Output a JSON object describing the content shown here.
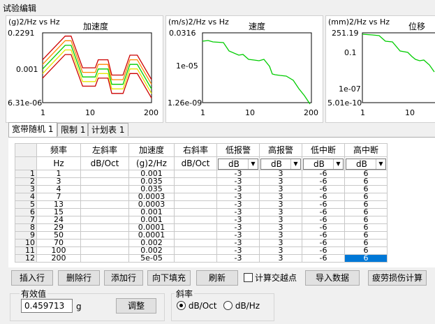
{
  "window": {
    "title": "试验编辑"
  },
  "colors": {
    "accent": "#0078d7",
    "green": "#00cc00",
    "red": "#cc0000",
    "orange": "#ff8800",
    "yellow": "#e6e600"
  },
  "charts": {
    "accel": {
      "ylabel": "(g)2/Hz vs Hz",
      "title": "加速度",
      "yticks": [
        "0.2291",
        "0.001",
        "6.31e-06"
      ],
      "xticks": [
        "1",
        "10",
        "200"
      ]
    },
    "vel": {
      "ylabel": "(m/s)2/Hz vs Hz",
      "title": "速度",
      "yticks": [
        "0.0316",
        "1e-05",
        "1.26e-09"
      ],
      "xticks": [
        "1",
        "10",
        "200"
      ]
    },
    "disp": {
      "ylabel": "(mm)2/Hz vs Hz",
      "title": "位移",
      "yticks": [
        "251.19",
        "0.1",
        "1e-07",
        "5.01e-10"
      ],
      "xticks": [
        "1",
        "10"
      ]
    }
  },
  "chart_data": [
    {
      "type": "line",
      "ylabel": "(g)2/Hz vs Hz",
      "title": "加速度",
      "xscale": "log",
      "yscale": "log",
      "xlim": [
        1,
        200
      ],
      "ylim": [
        6.31e-06,
        0.2291
      ],
      "x": [
        1,
        3,
        4,
        7,
        13,
        15,
        24,
        29,
        50,
        70,
        100,
        200
      ],
      "series": [
        {
          "values": [
            0.001,
            0.035,
            0.035,
            0.0003,
            0.0003,
            0.001,
            0.001,
            0.0001,
            0.0001,
            0.002,
            0.002,
            5e-05
          ]
        }
      ]
    },
    {
      "type": "line",
      "ylabel": "(m/s)2/Hz vs Hz",
      "title": "速度",
      "xscale": "log",
      "yscale": "log",
      "xlim": [
        1,
        200
      ],
      "ylim": [
        1.26e-09,
        0.0316
      ]
    },
    {
      "type": "line",
      "ylabel": "(mm)2/Hz vs Hz",
      "title": "位移",
      "xscale": "log",
      "yscale": "log",
      "ylim": [
        5.01e-10,
        251.19
      ]
    }
  ],
  "tabs": [
    "宽带随机 1",
    "限制 1",
    "计划表 1"
  ],
  "table": {
    "headers": [
      "频率",
      "左斜率",
      "加速度",
      "右斜率",
      "低报警",
      "高报警",
      "低中断",
      "高中断"
    ],
    "units": [
      "Hz",
      "dB/Oct",
      "(g)2/Hz",
      "dB/Oct",
      "dB",
      "dB",
      "dB",
      "dB"
    ],
    "rows": [
      {
        "n": "1",
        "freq": "1",
        "acc": "0.001",
        "lo_alarm": "-3",
        "hi_alarm": "3",
        "lo_abort": "-6",
        "hi_abort": "6"
      },
      {
        "n": "2",
        "freq": "3",
        "acc": "0.035",
        "lo_alarm": "-3",
        "hi_alarm": "3",
        "lo_abort": "-6",
        "hi_abort": "6"
      },
      {
        "n": "3",
        "freq": "4",
        "acc": "0.035",
        "lo_alarm": "-3",
        "hi_alarm": "3",
        "lo_abort": "-6",
        "hi_abort": "6"
      },
      {
        "n": "4",
        "freq": "7",
        "acc": "0.0003",
        "lo_alarm": "-3",
        "hi_alarm": "3",
        "lo_abort": "-6",
        "hi_abort": "6"
      },
      {
        "n": "5",
        "freq": "13",
        "acc": "0.0003",
        "lo_alarm": "-3",
        "hi_alarm": "3",
        "lo_abort": "-6",
        "hi_abort": "6"
      },
      {
        "n": "6",
        "freq": "15",
        "acc": "0.001",
        "lo_alarm": "-3",
        "hi_alarm": "3",
        "lo_abort": "-6",
        "hi_abort": "6"
      },
      {
        "n": "7",
        "freq": "24",
        "acc": "0.001",
        "lo_alarm": "-3",
        "hi_alarm": "3",
        "lo_abort": "-6",
        "hi_abort": "6"
      },
      {
        "n": "8",
        "freq": "29",
        "acc": "0.0001",
        "lo_alarm": "-3",
        "hi_alarm": "3",
        "lo_abort": "-6",
        "hi_abort": "6"
      },
      {
        "n": "9",
        "freq": "50",
        "acc": "0.0001",
        "lo_alarm": "-3",
        "hi_alarm": "3",
        "lo_abort": "-6",
        "hi_abort": "6"
      },
      {
        "n": "10",
        "freq": "70",
        "acc": "0.002",
        "lo_alarm": "-3",
        "hi_alarm": "3",
        "lo_abort": "-6",
        "hi_abort": "6"
      },
      {
        "n": "11",
        "freq": "100",
        "acc": "0.002",
        "lo_alarm": "-3",
        "hi_alarm": "3",
        "lo_abort": "-6",
        "hi_abort": "6"
      },
      {
        "n": "12",
        "freq": "200",
        "acc": "5e-05",
        "lo_alarm": "-3",
        "hi_alarm": "3",
        "lo_abort": "-6",
        "hi_abort": "6"
      }
    ]
  },
  "buttons": {
    "insert": "插入行",
    "delete": "删除行",
    "add": "添加行",
    "filldown": "向下填充",
    "refresh": "刷新",
    "cross": "计算交越点",
    "import": "导入数据",
    "fatigue": "疲劳损伤计算"
  },
  "rms": {
    "label": "有效值",
    "value": "0.459713",
    "unit": "g",
    "adjust": "调整"
  },
  "slope": {
    "label": "斜率",
    "opt1": "dB/Oct",
    "opt2": "dB/Hz",
    "selected": "dB/Oct"
  }
}
